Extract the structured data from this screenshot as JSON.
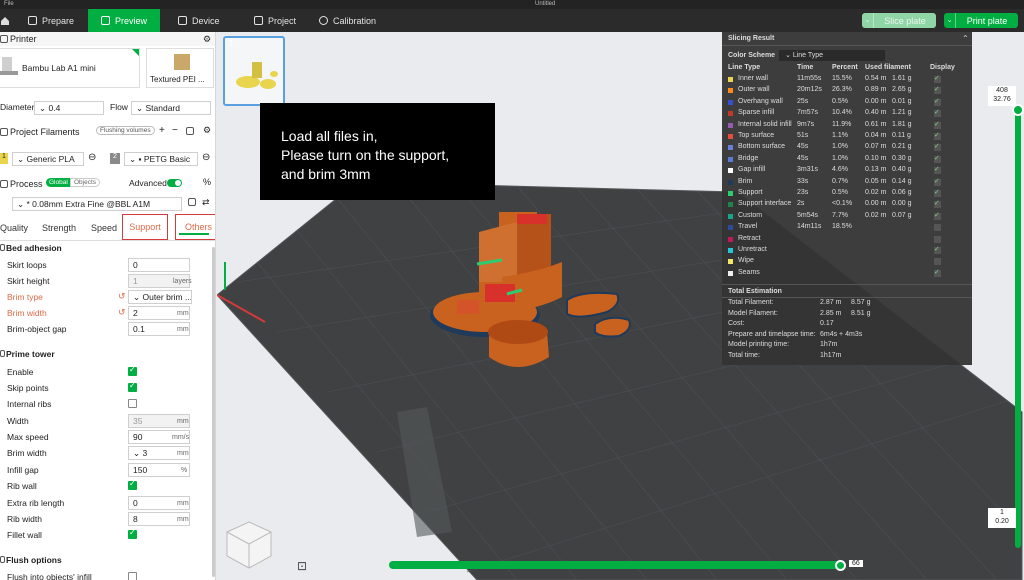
{
  "window": {
    "file_menu": "File",
    "title": "Untitled"
  },
  "topbar": {
    "tabs": [
      {
        "label": "Prepare"
      },
      {
        "label": "Preview"
      },
      {
        "label": "Device"
      },
      {
        "label": "Project"
      },
      {
        "label": "Calibration"
      }
    ],
    "slice_label": "Slice plate",
    "print_label": "Print plate"
  },
  "printer": {
    "section_title": "Printer",
    "model": "Bambu Lab A1 mini",
    "plate": "Textured PEI ..."
  },
  "diameter": {
    "label": "Diameter",
    "value": "0.4",
    "flow_label": "Flow",
    "flow_value": "Standard"
  },
  "filaments": {
    "section_title": "Project Filaments",
    "flushing_label": "Flushing volumes",
    "items": [
      {
        "index": "1",
        "name": "Generic PLA",
        "color": "#e8d44d"
      },
      {
        "index": "2",
        "name": "PETG Basic",
        "color": "#8a8a8a"
      }
    ]
  },
  "process": {
    "section_title": "Process",
    "global_label": "Global",
    "objects_label": "Objects",
    "advanced_label": "Advanced",
    "preset": "* 0.08mm Extra Fine @BBL A1M"
  },
  "tabs": [
    "Quality",
    "Strength",
    "Speed",
    "Support",
    "Others"
  ],
  "bed_adhesion": {
    "title": "Bed adhesion",
    "rows": [
      {
        "label": "Skirt loops",
        "value": "0",
        "unit": ""
      },
      {
        "label": "Skirt height",
        "value": "1",
        "unit": "layers"
      },
      {
        "label": "Brim type",
        "value": "Outer brim ...",
        "unit": ""
      },
      {
        "label": "Brim width",
        "value": "2",
        "unit": "mm"
      },
      {
        "label": "Brim-object gap",
        "value": "0.1",
        "unit": "mm"
      }
    ]
  },
  "prime_tower": {
    "title": "Prime tower",
    "rows": [
      {
        "label": "Enable",
        "checked": true
      },
      {
        "label": "Skip points",
        "checked": true
      },
      {
        "label": "Internal ribs",
        "checked": false
      },
      {
        "label": "Width",
        "value": "35",
        "unit": "mm"
      },
      {
        "label": "Max speed",
        "value": "90",
        "unit": "mm/s"
      },
      {
        "label": "Brim width",
        "value": "3",
        "unit": "mm"
      },
      {
        "label": "Infill gap",
        "value": "150",
        "unit": "%"
      },
      {
        "label": "Rib wall",
        "checked": true
      },
      {
        "label": "Extra rib length",
        "value": "0",
        "unit": "mm"
      },
      {
        "label": "Rib width",
        "value": "8",
        "unit": "mm"
      },
      {
        "label": "Fillet wall",
        "checked": true
      }
    ]
  },
  "flush": {
    "title": "Flush options",
    "item": "Flush into objects' infill"
  },
  "thumbnail": {
    "number": "1"
  },
  "note": {
    "line1": "Load all files in,",
    "line2": "Please turn on the support,",
    "line3": "and brim 3mm"
  },
  "slicing": {
    "title": "Slicing Result",
    "color_scheme_label": "Color Scheme",
    "color_scheme_value": "Line Type",
    "headers": {
      "type": "Line Type",
      "time": "Time",
      "percent": "Percent",
      "used": "Used filament",
      "display": "Display"
    },
    "rows": [
      {
        "name": "Inner wall",
        "color": "#e8d44d",
        "time": "11m55s",
        "percent": "15.5%",
        "len": "0.54 m",
        "g": "1.61 g",
        "display": true
      },
      {
        "name": "Outer wall",
        "color": "#ff8c1a",
        "time": "20m12s",
        "percent": "26.3%",
        "len": "0.89 m",
        "g": "2.65 g",
        "display": true
      },
      {
        "name": "Overhang wall",
        "color": "#3a4fd0",
        "time": "25s",
        "percent": "0.5%",
        "len": "0.00 m",
        "g": "0.01 g",
        "display": true
      },
      {
        "name": "Sparse infill",
        "color": "#c0392b",
        "time": "7m57s",
        "percent": "10.4%",
        "len": "0.40 m",
        "g": "1.21 g",
        "display": true
      },
      {
        "name": "Internal solid infill",
        "color": "#9b59b6",
        "time": "9m7s",
        "percent": "11.9%",
        "len": "0.61 m",
        "g": "1.81 g",
        "display": true
      },
      {
        "name": "Top surface",
        "color": "#e74c3c",
        "time": "51s",
        "percent": "1.1%",
        "len": "0.04 m",
        "g": "0.11 g",
        "display": true
      },
      {
        "name": "Bottom surface",
        "color": "#6a7fdb",
        "time": "45s",
        "percent": "1.0%",
        "len": "0.07 m",
        "g": "0.21 g",
        "display": true
      },
      {
        "name": "Bridge",
        "color": "#5a7bd6",
        "time": "45s",
        "percent": "1.0%",
        "len": "0.10 m",
        "g": "0.30 g",
        "display": true
      },
      {
        "name": "Gap infill",
        "color": "#ffffff",
        "time": "3m31s",
        "percent": "4.6%",
        "len": "0.13 m",
        "g": "0.40 g",
        "display": true
      },
      {
        "name": "Brim",
        "color": "#1f3a5a",
        "time": "33s",
        "percent": "0.7%",
        "len": "0.05 m",
        "g": "0.14 g",
        "display": true
      },
      {
        "name": "Support",
        "color": "#2ecc71",
        "time": "23s",
        "percent": "0.5%",
        "len": "0.02 m",
        "g": "0.06 g",
        "display": true
      },
      {
        "name": "Support interface",
        "color": "#1e8449",
        "time": "2s",
        "percent": "<0.1%",
        "len": "0.00 m",
        "g": "0.00 g",
        "display": true
      },
      {
        "name": "Custom",
        "color": "#17a589",
        "time": "5m54s",
        "percent": "7.7%",
        "len": "0.02 m",
        "g": "0.07 g",
        "display": true
      },
      {
        "name": "Travel",
        "color": "#2e4a9a",
        "time": "14m11s",
        "percent": "18.5%",
        "len": "",
        "g": "",
        "display": false
      },
      {
        "name": "Retract",
        "color": "#c2185b",
        "time": "",
        "percent": "",
        "len": "",
        "g": "",
        "display": false
      },
      {
        "name": "Unretract",
        "color": "#26c6da",
        "time": "",
        "percent": "",
        "len": "",
        "g": "",
        "display": true
      },
      {
        "name": "Wipe",
        "color": "#f1e76b",
        "time": "",
        "percent": "",
        "len": "",
        "g": "",
        "display": false
      },
      {
        "name": "Seams",
        "color": "#f0f0f0",
        "time": "",
        "percent": "",
        "len": "",
        "g": "",
        "display": true
      }
    ],
    "estimation": {
      "title": "Total Estimation",
      "rows": [
        {
          "label": "Total Filament:",
          "v1": "2.87 m",
          "v2": "8.57 g"
        },
        {
          "label": "Model Filament:",
          "v1": "2.85 m",
          "v2": "8.51 g"
        },
        {
          "label": "Cost:",
          "v1": "0.17",
          "v2": ""
        },
        {
          "label": "Prepare and timelapse time:",
          "v1": "6m4s + 4m3s",
          "v2": ""
        },
        {
          "label": "Model printing time:",
          "v1": "1h7m",
          "v2": ""
        },
        {
          "label": "Total time:",
          "v1": "1h17m",
          "v2": ""
        }
      ]
    }
  },
  "layer_slider": {
    "top_value": "408",
    "top_height": "32.76",
    "bottom_value": "1",
    "bottom_height": "0.20"
  },
  "move_slider": {
    "value": "66"
  },
  "colors": {
    "accent": "#00ae42",
    "model": "#c8621e",
    "plate": "#3f4143"
  }
}
